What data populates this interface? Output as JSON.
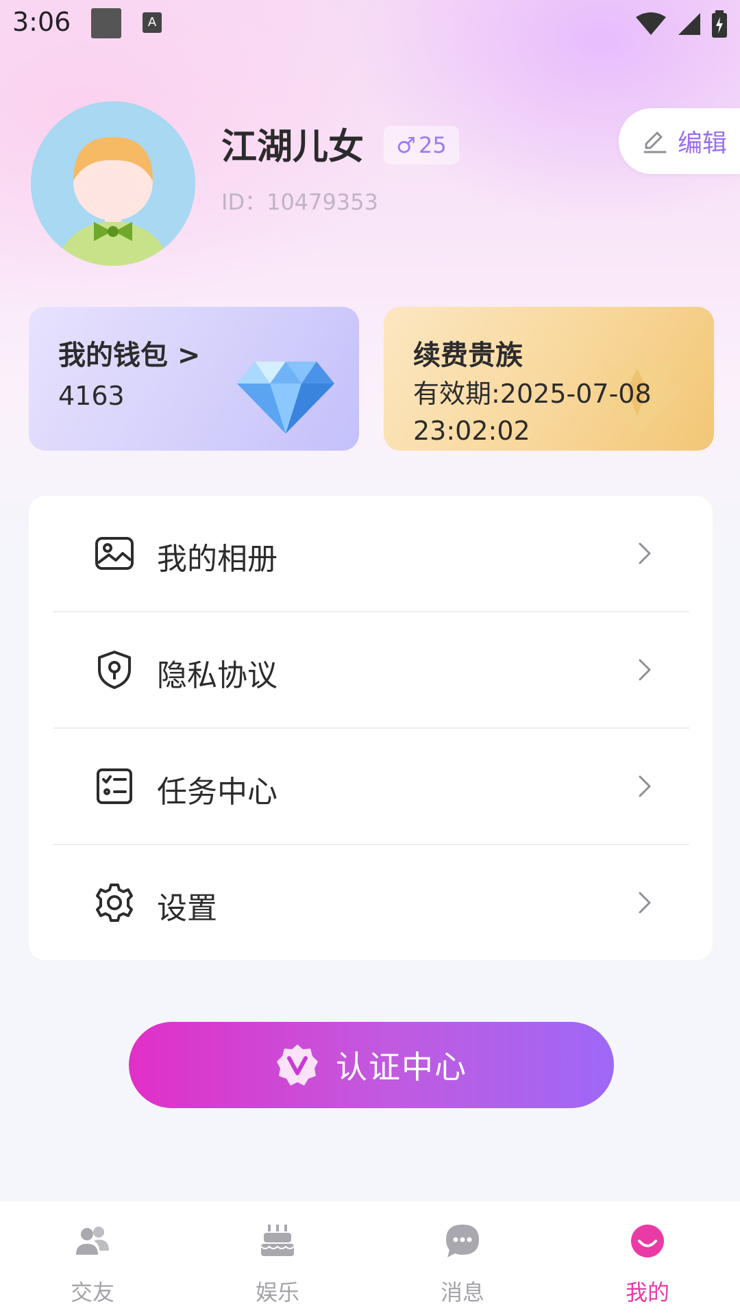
{
  "status_bar": {
    "time": "3:06",
    "keyboard_label": "A"
  },
  "profile": {
    "name": "江湖儿女",
    "gender_symbol": "♂",
    "age": "25",
    "id_text": "ID：10479353",
    "edit_label": "编辑"
  },
  "wallet": {
    "title": "我的钱包 >",
    "balance": "4163"
  },
  "vip": {
    "title": "续费贵族",
    "validity_line1": "有效期:2025-07-08",
    "validity_line2": "23:02:02"
  },
  "menu": {
    "items": [
      {
        "label": "我的相册",
        "icon": "album-icon"
      },
      {
        "label": "隐私协议",
        "icon": "privacy-shield-icon"
      },
      {
        "label": "任务中心",
        "icon": "task-list-icon"
      },
      {
        "label": "设置",
        "icon": "gear-icon"
      }
    ]
  },
  "cert": {
    "label": "认证中心",
    "badge_letter": "V"
  },
  "tabbar": {
    "tabs": [
      {
        "label": "交友",
        "icon": "friends-icon"
      },
      {
        "label": "娱乐",
        "icon": "cake-icon"
      },
      {
        "label": "消息",
        "icon": "message-icon"
      },
      {
        "label": "我的",
        "icon": "smile-icon",
        "active": true
      }
    ]
  },
  "colors": {
    "accent": "#ea3aa6",
    "edit_purple": "#9a6ef0",
    "cert_start": "#e12fc8",
    "cert_end": "#9e68f7"
  }
}
